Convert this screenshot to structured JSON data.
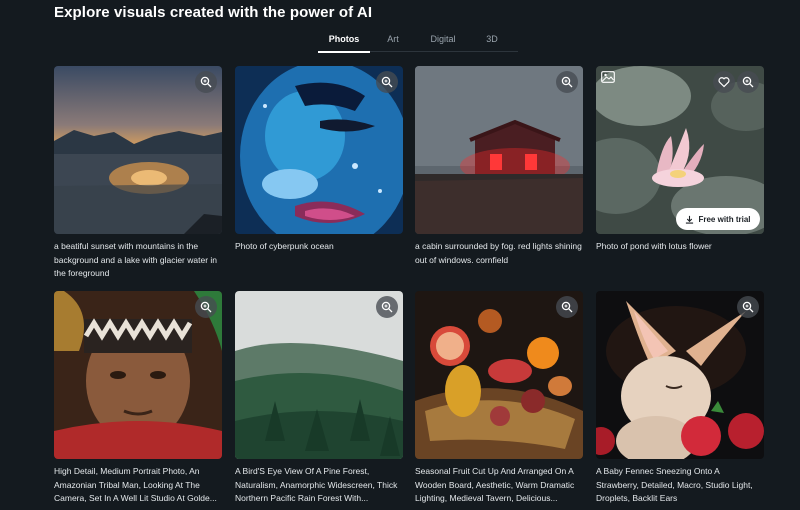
{
  "page": {
    "title": "Explore visuals created with the power of AI"
  },
  "tabs": [
    {
      "label": "Photos",
      "active": true
    },
    {
      "label": "Art",
      "active": false
    },
    {
      "label": "Digital",
      "active": false
    },
    {
      "label": "3D",
      "active": false
    }
  ],
  "cards": [
    {
      "caption": "a beatiful sunset with mountains in the background and a lake with glacier water in the foreground",
      "icon": "zoom-icon"
    },
    {
      "caption": "Photo of cyberpunk ocean",
      "icon": "zoom-icon"
    },
    {
      "caption": "a cabin surrounded by fog. red lights shining out of windows. cornfield",
      "icon": "zoom-icon"
    },
    {
      "caption": "Photo of pond with lotus flower",
      "icon": "zoom-icon",
      "cta": "Free with trial"
    },
    {
      "caption": "High Detail, Medium Portrait Photo, An Amazonian Tribal Man, Looking At The Camera, Set In A Well Lit Studio At Golde...",
      "icon": "zoom-icon"
    },
    {
      "caption": "A Bird'S Eye View Of A Pine Forest, Naturalism, Anamorphic Widescreen, Thick Northern Pacific Rain Forest With...",
      "icon": "zoom-icon"
    },
    {
      "caption": "Seasonal Fruit Cut Up And Arranged On A Wooden Board, Aesthetic, Warm Dramatic Lighting, Medieval Tavern, Delicious...",
      "icon": "zoom-icon"
    },
    {
      "caption": "A Baby Fennec Sneezing Onto A Strawberry, Detailed, Macro, Studio Light, Droplets, Backlit Ears",
      "icon": "zoom-icon"
    }
  ],
  "colors": {
    "background": "#141a1f",
    "cta_background": "#ffffff"
  }
}
